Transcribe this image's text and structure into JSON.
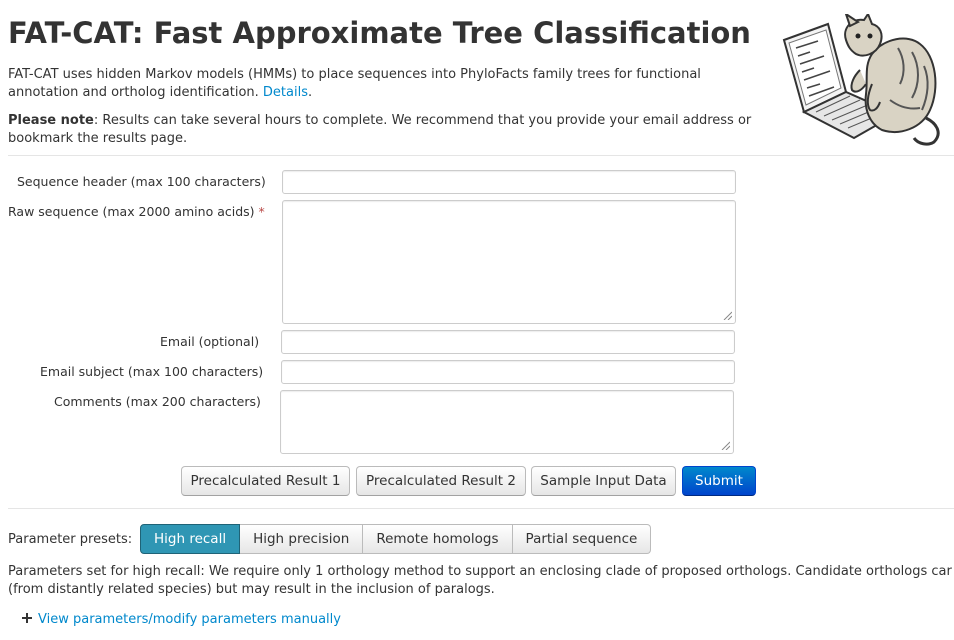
{
  "header": {
    "title": "FAT-CAT: Fast Approximate Tree Classification",
    "intro_text": "FAT-CAT uses hidden Markov models (HMMs) to place sequences into PhyloFacts family trees for functional annotation and ortholog identification.",
    "details_link": "Details",
    "note_label": "Please note",
    "note_text": ": Results can take several hours to complete. We recommend that you provide your email address or bookmark the results page.",
    "logo_icon": "cat-at-laptop-icon"
  },
  "form": {
    "sequence_header_label": "Sequence header (max 100 characters)",
    "sequence_header_value": "",
    "raw_sequence_label": "Raw sequence (max 2000 amino acids)",
    "required_mark": "*",
    "raw_sequence_value": "",
    "email_label": "Email (optional)",
    "email_value": "",
    "email_subject_label": "Email subject (max 100 characters)",
    "email_subject_value": "",
    "comments_label": "Comments (max 200 characters)",
    "comments_value": ""
  },
  "buttons": {
    "precalc1": "Precalculated Result 1",
    "precalc2": "Precalculated Result 2",
    "sample": "Sample Input Data",
    "submit": "Submit"
  },
  "presets": {
    "label": "Parameter presets:",
    "options": [
      "High recall",
      "High precision",
      "Remote homologs",
      "Partial sequence"
    ],
    "selected": "High recall",
    "description_line1": "Parameters set for high recall: We require only 1 orthology method to support an enclosing clade of proposed orthologs. Candidate orthologs car",
    "description_line2": "(from distantly related species) but may result in the inclusion of paralogs.",
    "toggle_text": "View parameters/modify parameters manually",
    "toggle_icon": "plus-icon"
  },
  "colors": {
    "link": "#0088cc",
    "primary": "#0044cc",
    "active_preset": "#2f96b4",
    "required": "#b94a48"
  }
}
